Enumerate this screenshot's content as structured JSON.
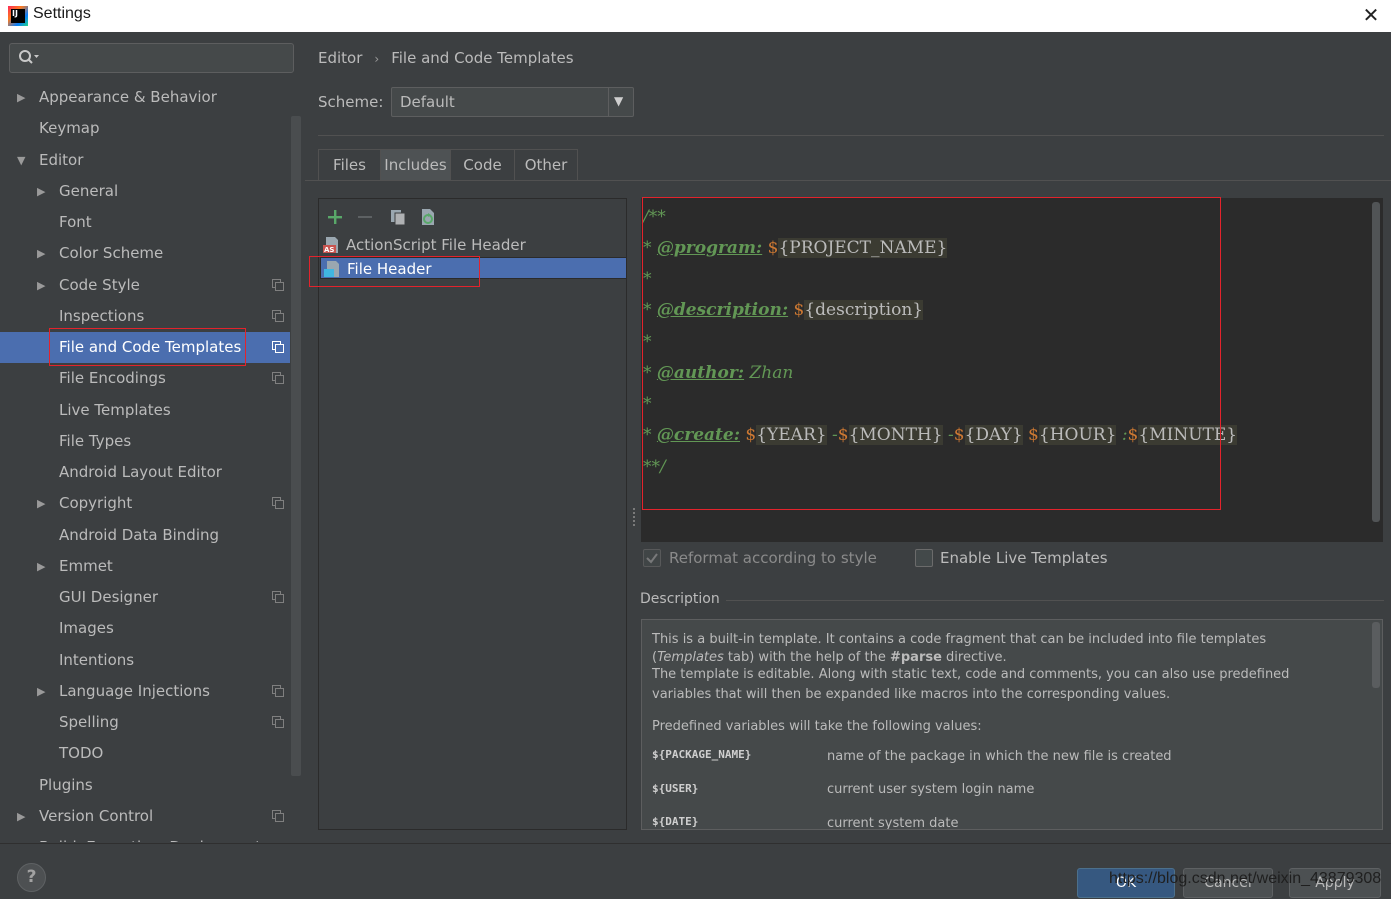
{
  "window": {
    "title": "Settings"
  },
  "search": {
    "placeholder": ""
  },
  "tree": [
    {
      "label": "Appearance & Behavior",
      "expand": "collapsed",
      "level": 0,
      "project_icon": false
    },
    {
      "label": "Keymap",
      "expand": "none",
      "level": 0,
      "project_icon": false
    },
    {
      "label": "Editor",
      "expand": "expanded",
      "level": 0,
      "project_icon": false
    },
    {
      "label": "General",
      "expand": "collapsed",
      "level": 1,
      "project_icon": false
    },
    {
      "label": "Font",
      "expand": "none",
      "level": 1,
      "project_icon": false
    },
    {
      "label": "Color Scheme",
      "expand": "collapsed",
      "level": 1,
      "project_icon": false
    },
    {
      "label": "Code Style",
      "expand": "collapsed",
      "level": 1,
      "project_icon": true
    },
    {
      "label": "Inspections",
      "expand": "none",
      "level": 1,
      "project_icon": true
    },
    {
      "label": "File and Code Templates",
      "expand": "none",
      "level": 1,
      "project_icon": true,
      "selected": true
    },
    {
      "label": "File Encodings",
      "expand": "none",
      "level": 1,
      "project_icon": true
    },
    {
      "label": "Live Templates",
      "expand": "none",
      "level": 1,
      "project_icon": false
    },
    {
      "label": "File Types",
      "expand": "none",
      "level": 1,
      "project_icon": false
    },
    {
      "label": "Android Layout Editor",
      "expand": "none",
      "level": 1,
      "project_icon": false
    },
    {
      "label": "Copyright",
      "expand": "collapsed",
      "level": 1,
      "project_icon": true
    },
    {
      "label": "Android Data Binding",
      "expand": "none",
      "level": 1,
      "project_icon": false
    },
    {
      "label": "Emmet",
      "expand": "collapsed",
      "level": 1,
      "project_icon": false
    },
    {
      "label": "GUI Designer",
      "expand": "none",
      "level": 1,
      "project_icon": true
    },
    {
      "label": "Images",
      "expand": "none",
      "level": 1,
      "project_icon": false
    },
    {
      "label": "Intentions",
      "expand": "none",
      "level": 1,
      "project_icon": false
    },
    {
      "label": "Language Injections",
      "expand": "collapsed",
      "level": 1,
      "project_icon": true
    },
    {
      "label": "Spelling",
      "expand": "none",
      "level": 1,
      "project_icon": true
    },
    {
      "label": "TODO",
      "expand": "none",
      "level": 1,
      "project_icon": false
    },
    {
      "label": "Plugins",
      "expand": "none",
      "level": 0,
      "project_icon": false
    },
    {
      "label": "Version Control",
      "expand": "collapsed",
      "level": 0,
      "project_icon": true
    },
    {
      "label": "Build, Execution, Deployment",
      "expand": "collapsed",
      "level": 0,
      "project_icon": false
    }
  ],
  "breadcrumb": {
    "parent": "Editor",
    "separator": "›",
    "current": "File and Code Templates"
  },
  "scheme": {
    "label": "Scheme:",
    "value": "Default"
  },
  "tabs": [
    "Files",
    "Includes",
    "Code",
    "Other"
  ],
  "active_tab": "Includes",
  "templates": [
    {
      "label": "ActionScript File Header",
      "icon": "actionscript-file-icon",
      "selected": false
    },
    {
      "label": "File Header",
      "icon": "file-header-icon",
      "selected": true
    }
  ],
  "editor": {
    "open": "/**",
    "star": "*",
    "program_tag": "@program:",
    "project_name": "{PROJECT_NAME}",
    "description_tag": "@description:",
    "description_var": "{description}",
    "author_tag": "@author:",
    "author": "Zhan",
    "create_tag": "@create:",
    "year": "{YEAR}",
    "month": "{MONTH}",
    "day": "{DAY}",
    "hour": "{HOUR}",
    "minute": "{MINUTE}",
    "dash": "-",
    "colon": ":",
    "dollar": "$",
    "close": "**/"
  },
  "options": {
    "reformat_label": "Reformat according to style",
    "reformat_checked": true,
    "live_label": "Enable Live Templates",
    "live_checked": false
  },
  "description": {
    "title": "Description",
    "line1": "This is a built-in template. It contains a code fragment that can be included into file templates",
    "line2_a": "(",
    "line2_em": "Templates",
    "line2_b": " tab) with the help of the ",
    "line2_strong": "#parse",
    "line2_c": " directive.",
    "line3": "The template is editable. Along with static text, code and comments, you can also use predefined",
    "line4": "variables that will then be expanded like macros into the corresponding values.",
    "line5": "Predefined variables will take the following values:",
    "vars": [
      {
        "name": "${PACKAGE_NAME}",
        "desc": "name of the package in which the new file is created"
      },
      {
        "name": "${USER}",
        "desc": "current user system login name"
      },
      {
        "name": "${DATE}",
        "desc": "current system date"
      }
    ]
  },
  "buttons": {
    "ok": "OK",
    "cancel": "Cancel",
    "apply": "Apply",
    "help": "?"
  },
  "watermark": "https://blog.csdn.net/weixin_43879308"
}
